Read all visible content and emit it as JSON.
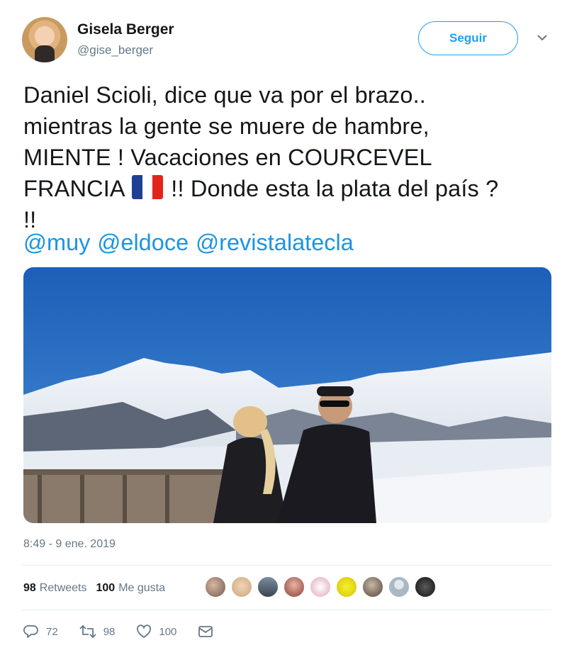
{
  "user": {
    "name": "Gisela Berger",
    "handle": "@gise_berger",
    "follow_label": "Seguir"
  },
  "tweet": {
    "lines": [
      "Daniel Scioli, dice que va por el brazo..",
      "mientras la gente se muere de hambre,",
      "MIENTE ! Vacaciones en COURCEVEL"
    ],
    "line4_before_flag": "FRANCIA",
    "line4_after_flag": "!! Donde esta la plata del país ?",
    "line5": "!!",
    "flag_colors": [
      "#1f3f95",
      "#ffffff",
      "#e1251b"
    ],
    "mentions": [
      "@muy",
      "@eldoce",
      "@revistalatecla"
    ]
  },
  "meta": {
    "timestamp": "8:49 - 9 ene. 2019"
  },
  "stats": {
    "retweets_count": "98",
    "retweets_label": "Retweets",
    "likes_count": "100",
    "likes_label": "Me gusta"
  },
  "actions": {
    "reply_count": "72",
    "retweet_count": "98",
    "like_count": "100"
  },
  "colors": {
    "accent": "#1da1f2",
    "mention": "#1b95e0",
    "secondary_text": "#657786",
    "divider": "#e6ecf0"
  }
}
